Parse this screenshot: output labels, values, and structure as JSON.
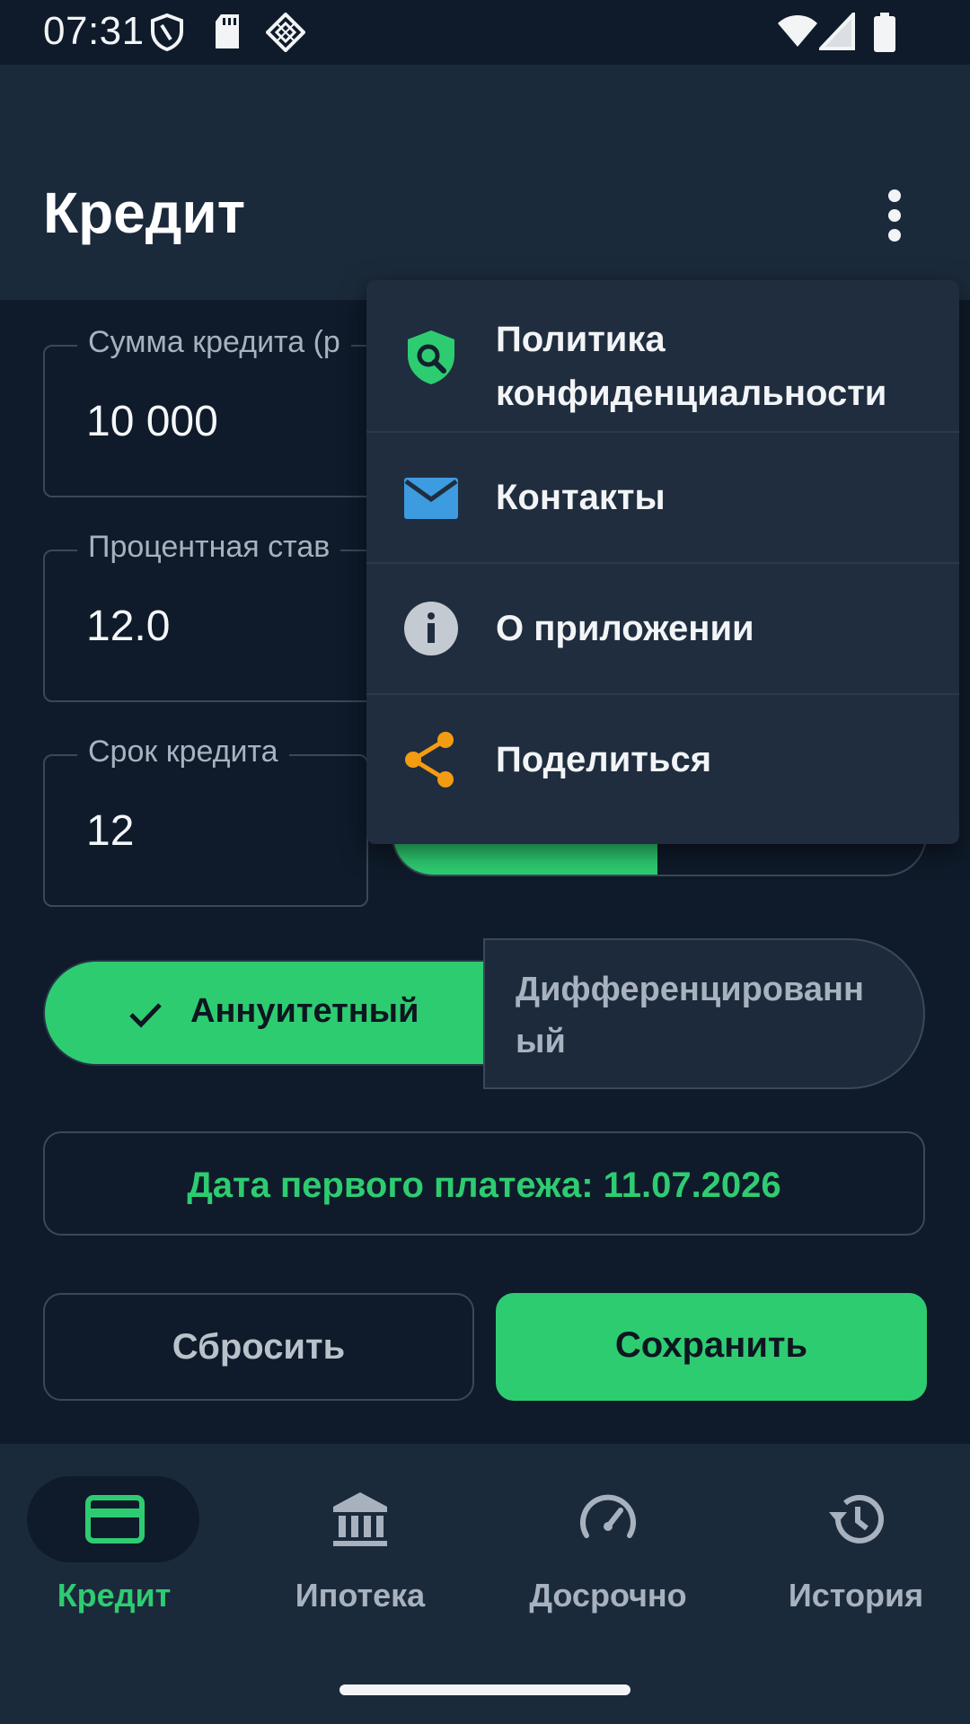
{
  "status_bar": {
    "time": "07:31"
  },
  "app_bar": {
    "title": "Кредит",
    "overflow_icon": "more-vert-icon"
  },
  "form": {
    "amount": {
      "label": "Сумма кредита (р",
      "value": "10 000"
    },
    "rate": {
      "label": "Процентная став",
      "value": "12.0"
    },
    "term": {
      "label": "Срок кредита",
      "value": "12"
    }
  },
  "payment_type": {
    "options": [
      "Аннуитетный",
      "Дифференцированный"
    ],
    "selected": "Аннуитетный"
  },
  "first_payment": {
    "text": "Дата первого платежа: 11.07.2026"
  },
  "actions": {
    "reset": "Сбросить",
    "save": "Сохранить"
  },
  "bottom_nav": {
    "items": [
      {
        "label": "Кредит",
        "icon": "credit-card-icon",
        "active": true
      },
      {
        "label": "Ипотека",
        "icon": "bank-icon",
        "active": false
      },
      {
        "label": "Досрочно",
        "icon": "speedometer-icon",
        "active": false
      },
      {
        "label": "История",
        "icon": "history-icon",
        "active": false
      }
    ]
  },
  "menu": {
    "items": [
      {
        "label": "Политика конфиденциальности",
        "icon": "shield-search-icon"
      },
      {
        "label": "Контакты",
        "icon": "mail-icon"
      },
      {
        "label": "О приложении",
        "icon": "info-icon"
      },
      {
        "label": "Поделиться",
        "icon": "share-icon"
      }
    ]
  },
  "colors": {
    "accent": "#2ecc71",
    "background": "#0f1b2a",
    "surface": "#1b2a3b",
    "menu_surface": "#1f2d3f",
    "mail_icon": "#3d9be0",
    "share_icon": "#f39c12"
  }
}
